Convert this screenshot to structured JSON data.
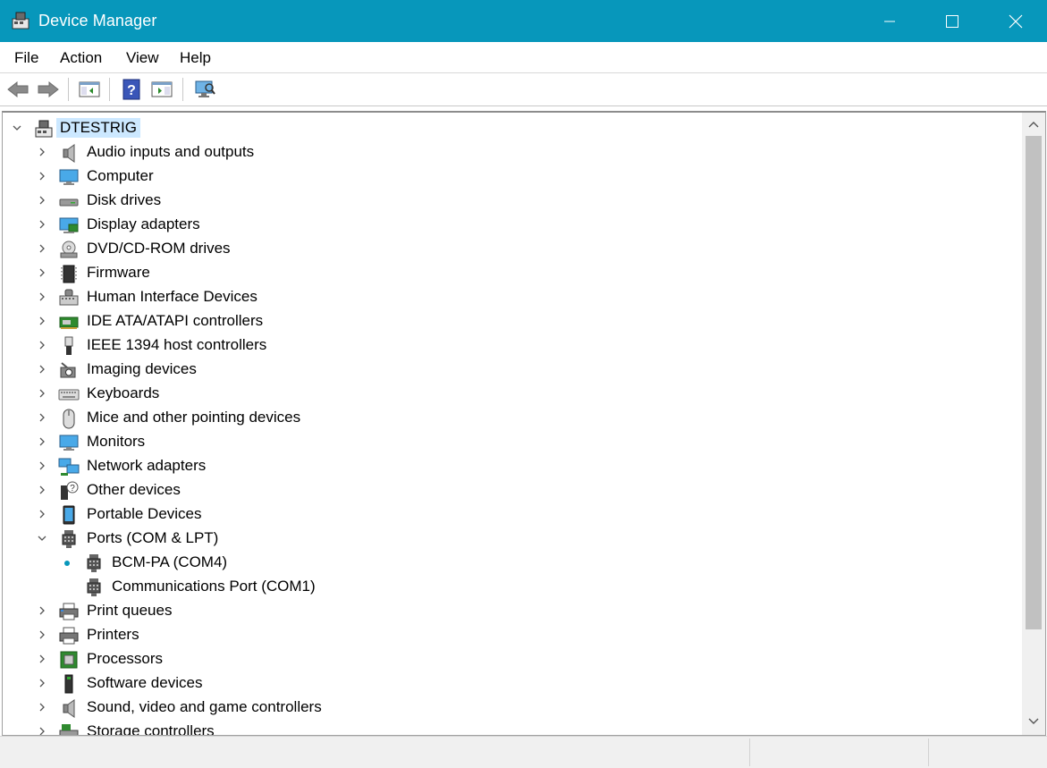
{
  "window": {
    "title": "Device Manager"
  },
  "menu": [
    "File",
    "Action",
    "View",
    "Help"
  ],
  "toolbar": {
    "buttons": [
      "back-icon",
      "forward-icon",
      "show-hide-console-tree-icon",
      "help-icon",
      "properties-pane-icon",
      "scan-hardware-icon"
    ]
  },
  "tree": {
    "root": {
      "label": "DTESTRIG",
      "expanded": true
    },
    "categories": [
      {
        "label": "Audio inputs and outputs",
        "icon": "speaker-icon"
      },
      {
        "label": "Computer",
        "icon": "computer-icon"
      },
      {
        "label": "Disk drives",
        "icon": "disk-drive-icon"
      },
      {
        "label": "Display adapters",
        "icon": "display-adapter-icon"
      },
      {
        "label": "DVD/CD-ROM drives",
        "icon": "dvd-drive-icon"
      },
      {
        "label": "Firmware",
        "icon": "firmware-chip-icon"
      },
      {
        "label": "Human Interface Devices",
        "icon": "hid-icon"
      },
      {
        "label": "IDE ATA/ATAPI controllers",
        "icon": "ide-controller-icon"
      },
      {
        "label": "IEEE 1394 host controllers",
        "icon": "ieee1394-icon"
      },
      {
        "label": "Imaging devices",
        "icon": "camera-icon"
      },
      {
        "label": "Keyboards",
        "icon": "keyboard-icon"
      },
      {
        "label": "Mice and other pointing devices",
        "icon": "mouse-icon"
      },
      {
        "label": "Monitors",
        "icon": "monitor-icon"
      },
      {
        "label": "Network adapters",
        "icon": "network-adapter-icon"
      },
      {
        "label": "Other devices",
        "icon": "unknown-device-icon"
      },
      {
        "label": "Portable Devices",
        "icon": "portable-device-icon"
      },
      {
        "label": "Ports (COM & LPT)",
        "icon": "port-icon",
        "expanded": true,
        "children": [
          {
            "label": "BCM-PA (COM4)",
            "icon": "port-icon",
            "new": true
          },
          {
            "label": "Communications Port (COM1)",
            "icon": "port-icon"
          }
        ]
      },
      {
        "label": "Print queues",
        "icon": "print-queue-icon"
      },
      {
        "label": "Printers",
        "icon": "printer-icon"
      },
      {
        "label": "Processors",
        "icon": "processor-icon"
      },
      {
        "label": "Software devices",
        "icon": "software-device-icon"
      },
      {
        "label": "Sound, video and game controllers",
        "icon": "speaker-icon"
      },
      {
        "label": "Storage controllers",
        "icon": "storage-controller-icon"
      }
    ]
  },
  "colors": {
    "titlebar": "#0797bb",
    "selection": "#cce8ff",
    "new_device_dot": "#0797bb"
  }
}
